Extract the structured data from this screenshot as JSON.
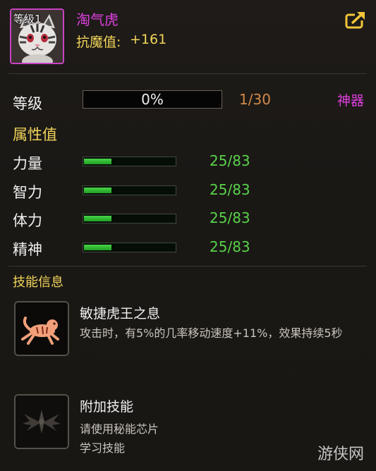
{
  "pet": {
    "level_badge": "等级1",
    "name": "淘气虎",
    "magic_resistance_label": "抗魔值:",
    "magic_resistance_value": "+161"
  },
  "level": {
    "label": "等级",
    "progress_text": "0%",
    "progress_fraction": 0.0,
    "count": "1/30",
    "artifact_link": "神器"
  },
  "attributes": {
    "title": "属性值",
    "items": [
      {
        "label": "力量",
        "value": "25/83",
        "fill_fraction": 0.3012
      },
      {
        "label": "智力",
        "value": "25/83",
        "fill_fraction": 0.3012
      },
      {
        "label": "体力",
        "value": "25/83",
        "fill_fraction": 0.3012
      },
      {
        "label": "精神",
        "value": "25/83",
        "fill_fraction": 0.3012
      }
    ]
  },
  "skills": {
    "title": "技能信息",
    "items": [
      {
        "name": "敏捷虎王之息",
        "desc_lines": [
          "攻击时，有5%的几率移动速度+11%，效果持续5秒"
        ],
        "icon": "tiger-dash-icon"
      },
      {
        "name": "附加技能",
        "desc_lines": [
          "请使用秘能芯片",
          "学习技能"
        ],
        "icon": "winged-emblem-icon"
      }
    ]
  },
  "watermark": "游侠网",
  "colors": {
    "name_magenta": "#e040e0",
    "gold": "#f2d55a",
    "green_value": "#59d24a",
    "orange_count": "#d38a4a"
  }
}
